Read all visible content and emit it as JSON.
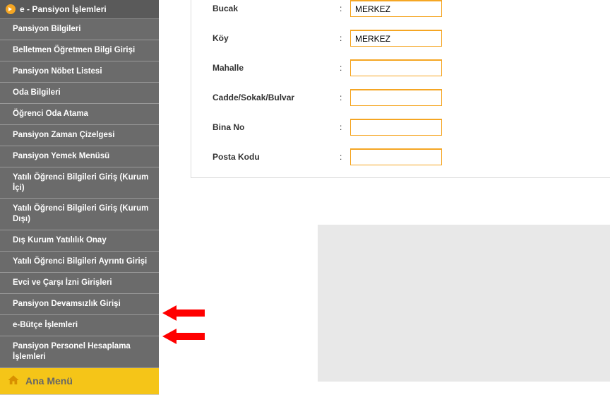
{
  "sidebar": {
    "header": "e - Pansiyon İşlemleri",
    "items": [
      "Pansiyon Bilgileri",
      "Belletmen Öğretmen Bilgi Girişi",
      "Pansiyon Nöbet Listesi",
      "Oda Bilgileri",
      "Öğrenci Oda Atama",
      "Pansiyon Zaman Çizelgesi",
      "Pansiyon Yemek Menüsü",
      "Yatılı Öğrenci Bilgileri Giriş (Kurum İçi)",
      "Yatılı Öğrenci Bilgileri Giriş (Kurum Dışı)",
      "Dış Kurum Yatılılık Onay",
      "Yatılı Öğrenci Bilgileri Ayrıntı Girişi",
      "Evci ve Çarşı İzni Girişleri",
      "Pansiyon Devamsızlık Girişi",
      "e-Bütçe İşlemleri",
      "Pansiyon Personel Hesaplama İşlemleri"
    ],
    "ana_menu": "Ana Menü"
  },
  "form": {
    "fields": [
      {
        "label": "Bucak",
        "value": "MERKEZ"
      },
      {
        "label": "Köy",
        "value": "MERKEZ"
      },
      {
        "label": "Mahalle",
        "value": ""
      },
      {
        "label": "Cadde/Sokak/Bulvar",
        "value": ""
      },
      {
        "label": "Bina No",
        "value": ""
      },
      {
        "label": "Posta Kodu",
        "value": ""
      }
    ],
    "colon": ":"
  }
}
